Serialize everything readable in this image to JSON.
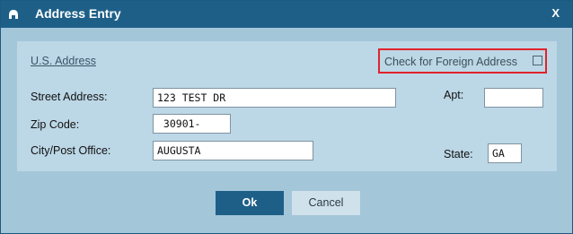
{
  "window": {
    "title": "Address Entry",
    "close_label": "X"
  },
  "section": {
    "us_address_link": "U.S. Address",
    "foreign_label": "Check for Foreign Address",
    "foreign_checked": false
  },
  "fields": {
    "street": {
      "label": "Street Address:",
      "value": "123 TEST DR"
    },
    "apt": {
      "label": "Apt:",
      "value": ""
    },
    "zip": {
      "label": "Zip Code:",
      "value": " 30901-"
    },
    "city": {
      "label": "City/Post Office:",
      "value": "AUGUSTA"
    },
    "state": {
      "label": "State:",
      "value": "GA"
    }
  },
  "buttons": {
    "ok": "Ok",
    "cancel": "Cancel"
  },
  "colors": {
    "titlebar": "#1e5f88",
    "dialog_bg": "#a4c6d9",
    "panel_bg": "#bcd7e6",
    "highlight_border": "#e0232c"
  },
  "icons": {
    "title_icon": "app-helmet-icon"
  }
}
